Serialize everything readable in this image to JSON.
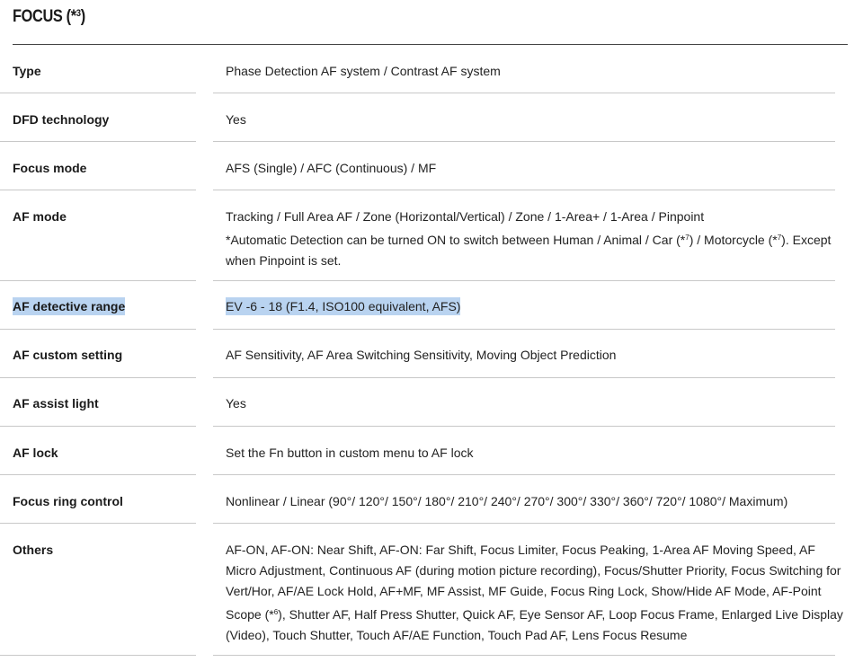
{
  "section": {
    "title": "FOCUS (*",
    "title_note": "3",
    "title_close": ")"
  },
  "rows": [
    {
      "label": "Type",
      "value": "Phase Detection AF system / Contrast AF system"
    },
    {
      "label": "DFD technology",
      "value": "Yes"
    },
    {
      "label": "Focus mode",
      "value": "AFS (Single) / AFC (Continuous) / MF"
    },
    {
      "label": "AF mode",
      "value_line1": "Tracking / Full Area AF / Zone (Horizontal/Vertical) / Zone / 1-Area+ / 1-Area / Pinpoint",
      "value_line2_a": "*Automatic Detection can be turned ON to switch between Human / Animal / Car (*",
      "value_line2_note1": "7",
      "value_line2_b": ") / Motorcycle (*",
      "value_line2_note2": "7",
      "value_line2_c": "). Except when Pinpoint is set."
    },
    {
      "label": "AF detective range",
      "value": "EV -6 - 18 (F1.4, ISO100 equivalent, AFS)"
    },
    {
      "label": "AF custom setting",
      "value": "AF Sensitivity, AF Area Switching Sensitivity, Moving Object Prediction"
    },
    {
      "label": "AF assist light",
      "value": "Yes"
    },
    {
      "label": "AF lock",
      "value": "Set the Fn button in custom menu to AF lock"
    },
    {
      "label": "Focus ring control",
      "value": "Nonlinear / Linear (90°/ 120°/ 150°/ 180°/ 210°/ 240°/ 270°/ 300°/ 330°/ 360°/ 720°/ 1080°/ Maximum)"
    },
    {
      "label": "Others",
      "value_a": "AF-ON, AF-ON: Near Shift, AF-ON: Far Shift, Focus Limiter, Focus Peaking, 1-Area AF Moving Speed, AF Micro Adjustment, Continuous AF (during motion picture recording), Focus/Shutter Priority, Focus Switching for Vert/Hor, AF/AE Lock Hold, AF+MF, MF Assist, MF Guide, Focus Ring Lock, Show/Hide AF Mode, AF-Point Scope (*",
      "value_note": "6",
      "value_b": "), Shutter AF, Half Press Shutter, Quick AF, Eye Sensor AF, Loop Focus Frame, Enlarged Live Display (Video), Touch Shutter, Touch AF/AE Function, Touch Pad AF, Lens Focus Resume"
    }
  ]
}
